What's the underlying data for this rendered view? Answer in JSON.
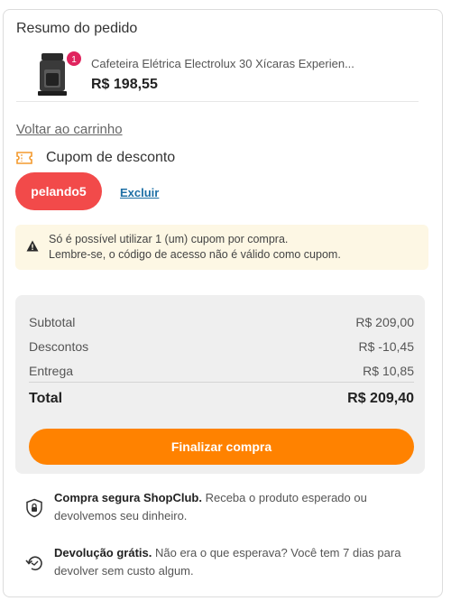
{
  "summary": {
    "title": "Resumo do pedido",
    "product": {
      "quantity": "1",
      "name": "Cafeteira Elétrica Electrolux 30 Xícaras Experien...",
      "price": "R$ 198,55"
    }
  },
  "back_link": "Voltar ao carrinho",
  "coupon": {
    "title": "Cupom de desconto",
    "code": "pelando5",
    "remove_label": "Excluir",
    "notice_line1": "Só é possível utilizar 1 (um) cupom por compra.",
    "notice_line2": "Lembre-se, o código de acesso não é válido como cupom."
  },
  "totals": {
    "subtotal_label": "Subtotal",
    "subtotal_value": "R$ 209,00",
    "discount_label": "Descontos",
    "discount_value": "R$ -10,45",
    "shipping_label": "Entrega",
    "shipping_value": "R$ 10,85",
    "total_label": "Total",
    "total_value": "R$ 209,40",
    "checkout_label": "Finalizar compra"
  },
  "info": {
    "secure_title": "Compra segura ShopClub.",
    "secure_text": " Receba o produto esperado ou devolvemos seu dinheiro.",
    "return_title": "Devolução grátis.",
    "return_text": " Não era o que esperava? Você tem 7 dias para devolver sem custo algum."
  },
  "colors": {
    "accent_orange": "#ff8200",
    "coupon_red": "#f24a4a",
    "badge_pink": "#e0245e",
    "link_blue": "#1d6fa5"
  }
}
